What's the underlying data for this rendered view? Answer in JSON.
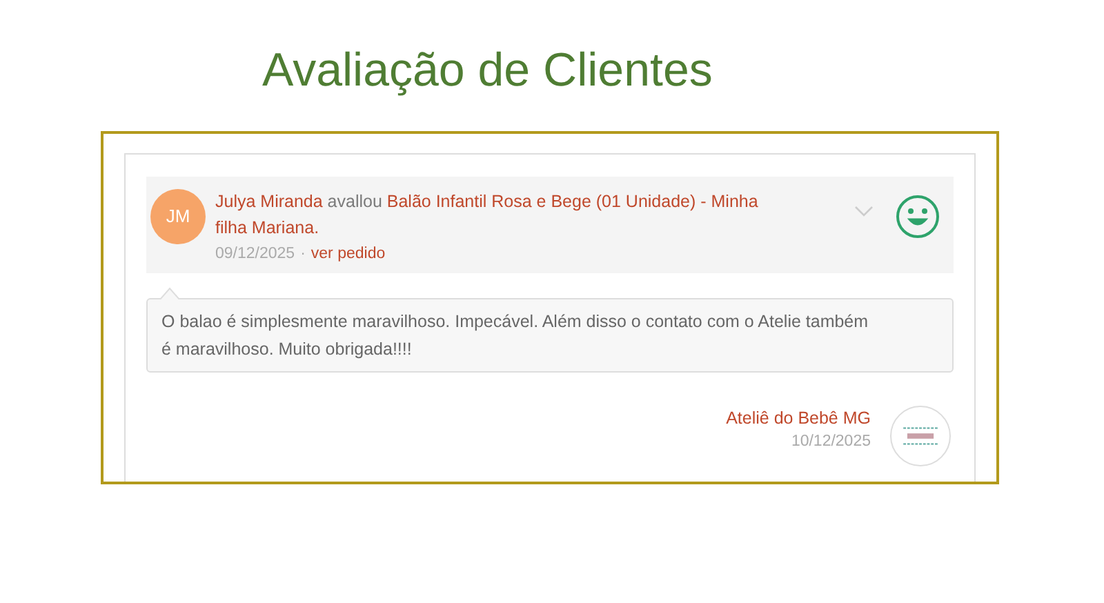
{
  "title": "Avaliação de Clientes",
  "review": {
    "avatar_initials": "JM",
    "author": "Julya Miranda",
    "verb": "avallou",
    "product": "Balão Infantil Rosa e Bege (01 Unidade) - Minha filha Mariana.",
    "date": "09/12/2025",
    "separator": "·",
    "order_link": "ver pedido",
    "expanded": false,
    "comment": "O balao é simplesmente maravilhoso. Impecável. Além disso o contato com o Atelie também é maravilhoso. Muito obrigada!!!!"
  },
  "reply": {
    "store": "Ateliê do Bebê MG",
    "date": "10/12/2025"
  }
}
